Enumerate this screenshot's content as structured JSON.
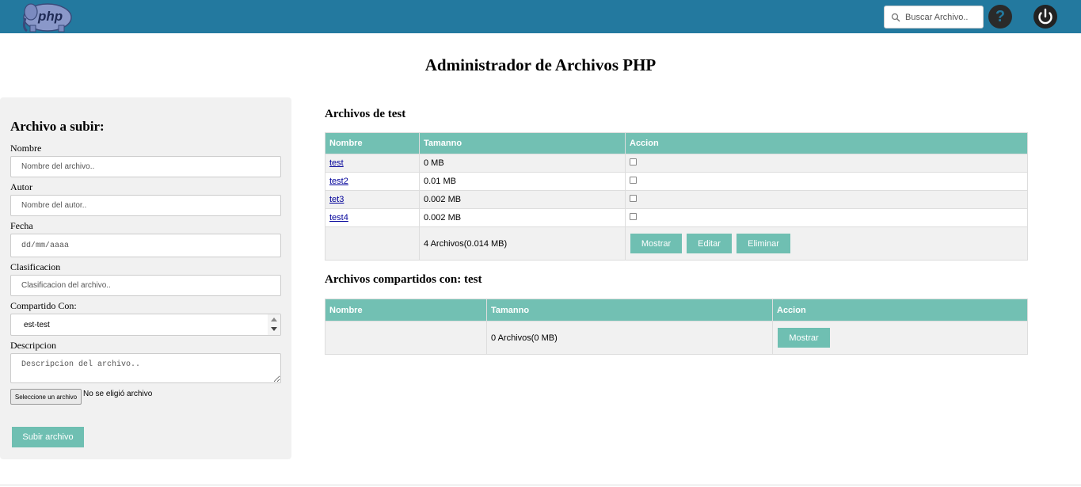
{
  "header": {
    "logo_text": "php",
    "search_placeholder": "Buscar Archivo..",
    "help_label": "?"
  },
  "page_title": "Administrador de Archivos PHP",
  "upload_form": {
    "title": "Archivo a subir:",
    "nombre_label": "Nombre",
    "nombre_placeholder": "Nombre del archivo..",
    "autor_label": "Autor",
    "autor_placeholder": "Nombre del autor..",
    "fecha_label": "Fecha",
    "fecha_placeholder": "dd/mm/aaaa",
    "clasificacion_label": "Clasificacion",
    "clasificacion_placeholder": "Clasificacion del archivo..",
    "compartido_label": "Compartido Con:",
    "compartido_value": "est-test",
    "descripcion_label": "Descripcion",
    "descripcion_placeholder": "Descripcion del archivo..",
    "file_button": "Seleccione un archivo",
    "file_status": "No se eligió archivo",
    "submit": "Subir archivo"
  },
  "own_files": {
    "title": "Archivos de test",
    "headers": [
      "Nombre",
      "Tamanno",
      "Accion"
    ],
    "rows": [
      {
        "name": "test",
        "size": "0 MB"
      },
      {
        "name": "test2",
        "size": "0.01 MB"
      },
      {
        "name": "tet3",
        "size": "0.002 MB"
      },
      {
        "name": "test4",
        "size": "0.002 MB"
      }
    ],
    "summary": "4 Archivos(0.014 MB)",
    "buttons": {
      "show": "Mostrar",
      "edit": "Editar",
      "delete": "Eliminar"
    }
  },
  "shared_files": {
    "title": "Archivos compartidos con: test",
    "headers": [
      "Nombre",
      "Tamanno",
      "Accion"
    ],
    "summary": "0 Archivos(0 MB)",
    "show_button": "Mostrar"
  },
  "colors": {
    "topbar": "#23799f",
    "accent": "#72c0b3",
    "panel_bg": "#f1f1f1"
  }
}
